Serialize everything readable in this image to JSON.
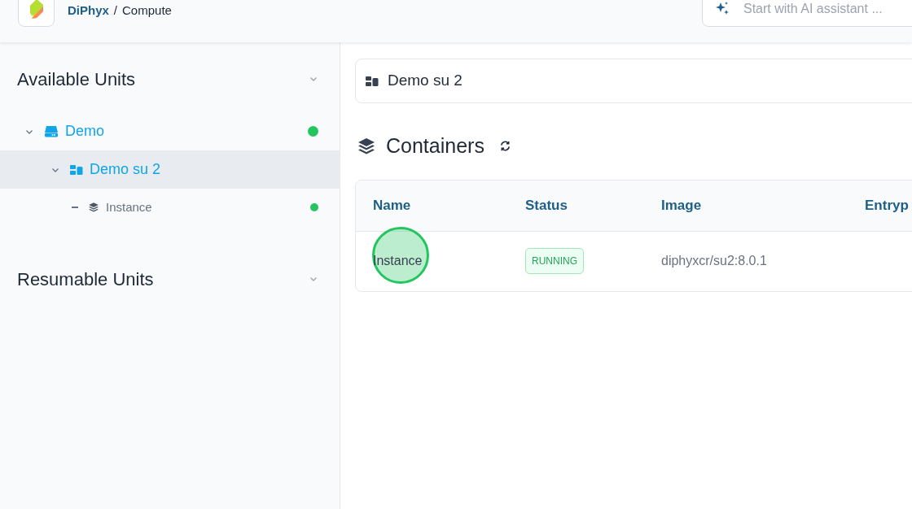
{
  "header": {
    "brand": "DiPhyx",
    "separator": "/",
    "page": "Compute",
    "assistant": {
      "placeholder": "Start with AI assistant ..."
    }
  },
  "sidebar": {
    "sections": [
      {
        "title": "Available Units",
        "tree": [
          {
            "label": "Demo",
            "kind": "server",
            "expanded": true,
            "selected": false,
            "color": "#22c55e",
            "children": [
              {
                "label": "Demo su 2",
                "kind": "unit",
                "expanded": true,
                "selected": true,
                "children": [
                  {
                    "label": "Instance",
                    "kind": "instance",
                    "selected": false,
                    "color": "#22c55e"
                  }
                ]
              }
            ]
          }
        ]
      },
      {
        "title": "Resumable Units"
      }
    ]
  },
  "main": {
    "unit_title": "Demo su 2",
    "containers": {
      "title": "Containers",
      "columns": [
        "Name",
        "Status",
        "Image",
        "Entryp"
      ],
      "rows": [
        {
          "name": "Instance",
          "status": "RUNNING",
          "image": "diphyxcr/su2:8.0.1"
        }
      ]
    },
    "click_marker": true
  }
}
